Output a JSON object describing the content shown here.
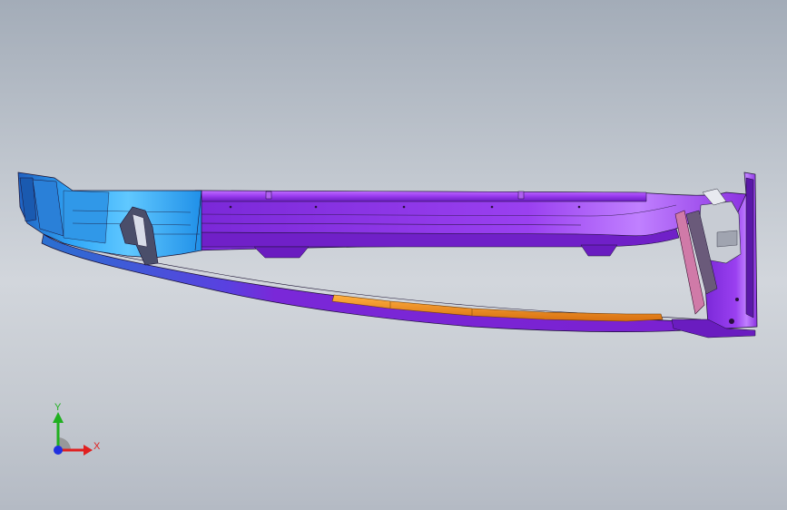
{
  "viewport": {
    "background_top": "#a3acb8",
    "background_mid": "#d2d6dc",
    "background_bottom": "#b4bac4"
  },
  "model": {
    "colors": {
      "purple": "#8a2be2",
      "purple_dark": "#5a1a9e",
      "purple_light": "#b060f0",
      "blue": "#1e90e8",
      "blue_light": "#40b0f8",
      "blue_dark": "#1060b0",
      "orange": "#f0901e",
      "pink": "#d87aa0",
      "gray": "#b8b8c0",
      "edge": "#1a1030"
    }
  },
  "triad": {
    "x_label": "X",
    "y_label": "Y",
    "x_color": "#e02020",
    "y_color": "#20b020",
    "z_color": "#2030e0"
  }
}
